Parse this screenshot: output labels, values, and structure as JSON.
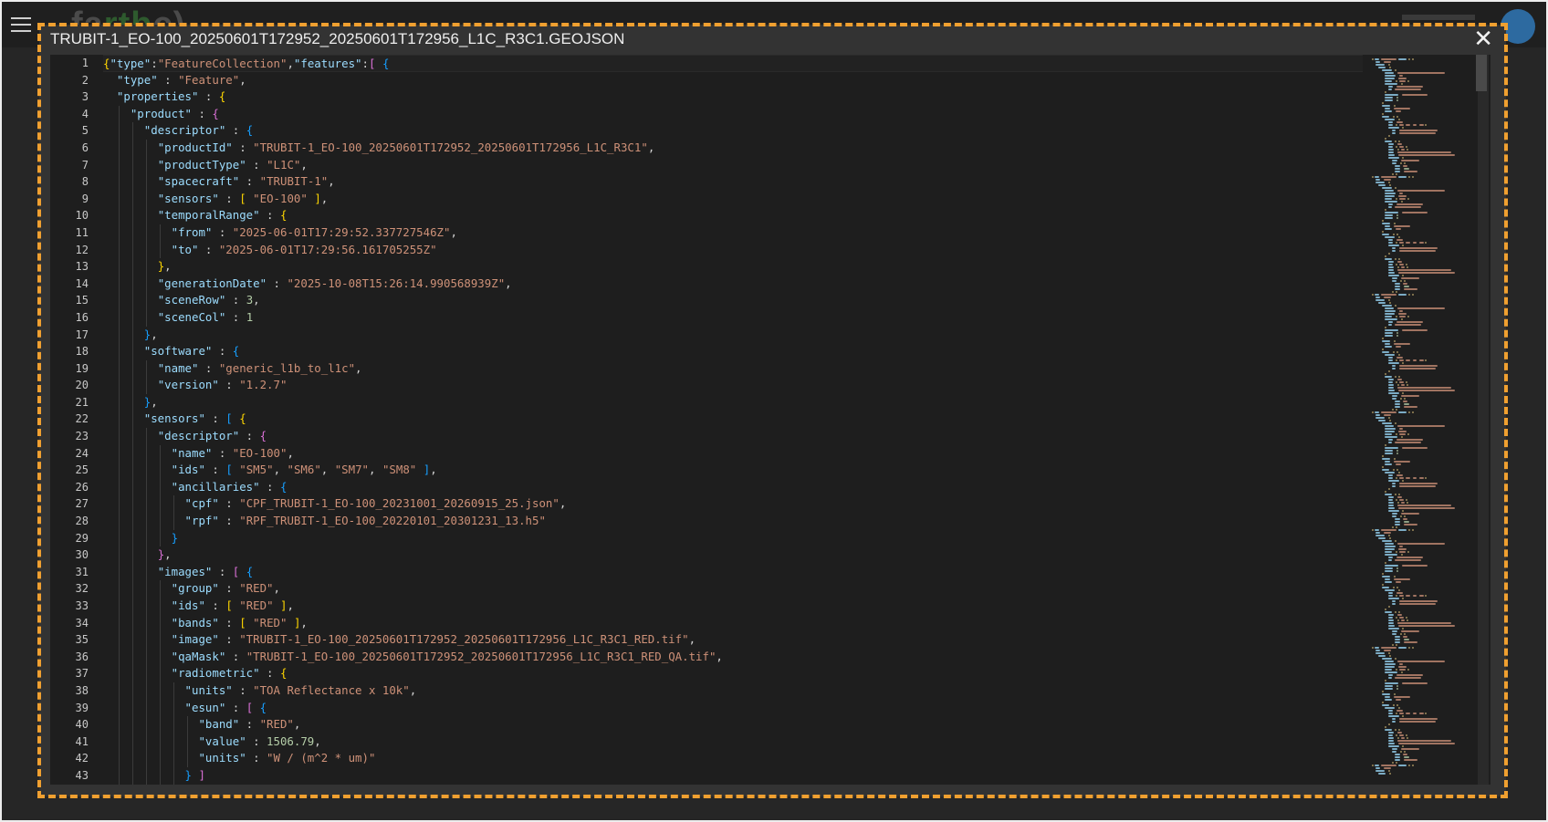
{
  "app": {
    "logo_text": "fa",
    "logo_accent": "rth",
    "logo_tail": "c)"
  },
  "modal": {
    "title": "TRUBIT-1_EO-100_20250601T172952_20250601T172956_L1C_R3C1.GEOJSON",
    "close_label": "✕"
  },
  "editor": {
    "language": "json",
    "visible_lines": [
      [
        [
          "b1",
          "{"
        ],
        [
          "k",
          "\"type\""
        ],
        [
          "p",
          ":"
        ],
        [
          "s",
          "\"FeatureCollection\""
        ],
        [
          "p",
          ","
        ],
        [
          "k",
          "\"features\""
        ],
        [
          "p",
          ":"
        ],
        [
          "b2",
          "["
        ],
        [
          "p",
          " "
        ],
        [
          "b3",
          "{"
        ]
      ],
      [
        [
          "p",
          "  "
        ],
        [
          "k",
          "\"type\""
        ],
        [
          "p",
          " : "
        ],
        [
          "s",
          "\"Feature\""
        ],
        [
          "p",
          ","
        ]
      ],
      [
        [
          "p",
          "  "
        ],
        [
          "k",
          "\"properties\""
        ],
        [
          "p",
          " : "
        ],
        [
          "b1",
          "{"
        ]
      ],
      [
        [
          "p",
          "    "
        ],
        [
          "k",
          "\"product\""
        ],
        [
          "p",
          " : "
        ],
        [
          "b2",
          "{"
        ]
      ],
      [
        [
          "p",
          "      "
        ],
        [
          "k",
          "\"descriptor\""
        ],
        [
          "p",
          " : "
        ],
        [
          "b3",
          "{"
        ]
      ],
      [
        [
          "p",
          "        "
        ],
        [
          "k",
          "\"productId\""
        ],
        [
          "p",
          " : "
        ],
        [
          "s",
          "\"TRUBIT-1_EO-100_20250601T172952_20250601T172956_L1C_R3C1\""
        ],
        [
          "p",
          ","
        ]
      ],
      [
        [
          "p",
          "        "
        ],
        [
          "k",
          "\"productType\""
        ],
        [
          "p",
          " : "
        ],
        [
          "s",
          "\"L1C\""
        ],
        [
          "p",
          ","
        ]
      ],
      [
        [
          "p",
          "        "
        ],
        [
          "k",
          "\"spacecraft\""
        ],
        [
          "p",
          " : "
        ],
        [
          "s",
          "\"TRUBIT-1\""
        ],
        [
          "p",
          ","
        ]
      ],
      [
        [
          "p",
          "        "
        ],
        [
          "k",
          "\"sensors\""
        ],
        [
          "p",
          " : "
        ],
        [
          "b1",
          "["
        ],
        [
          "p",
          " "
        ],
        [
          "s",
          "\"EO-100\""
        ],
        [
          "p",
          " "
        ],
        [
          "b1",
          "]"
        ],
        [
          "p",
          ","
        ]
      ],
      [
        [
          "p",
          "        "
        ],
        [
          "k",
          "\"temporalRange\""
        ],
        [
          "p",
          " : "
        ],
        [
          "b1",
          "{"
        ]
      ],
      [
        [
          "p",
          "          "
        ],
        [
          "k",
          "\"from\""
        ],
        [
          "p",
          " : "
        ],
        [
          "s",
          "\"2025-06-01T17:29:52.337727546Z\""
        ],
        [
          "p",
          ","
        ]
      ],
      [
        [
          "p",
          "          "
        ],
        [
          "k",
          "\"to\""
        ],
        [
          "p",
          " : "
        ],
        [
          "s",
          "\"2025-06-01T17:29:56.161705255Z\""
        ]
      ],
      [
        [
          "p",
          "        "
        ],
        [
          "b1",
          "}"
        ],
        [
          "p",
          ","
        ]
      ],
      [
        [
          "p",
          "        "
        ],
        [
          "k",
          "\"generationDate\""
        ],
        [
          "p",
          " : "
        ],
        [
          "s",
          "\"2025-10-08T15:26:14.990568939Z\""
        ],
        [
          "p",
          ","
        ]
      ],
      [
        [
          "p",
          "        "
        ],
        [
          "k",
          "\"sceneRow\""
        ],
        [
          "p",
          " : "
        ],
        [
          "n",
          "3"
        ],
        [
          "p",
          ","
        ]
      ],
      [
        [
          "p",
          "        "
        ],
        [
          "k",
          "\"sceneCol\""
        ],
        [
          "p",
          " : "
        ],
        [
          "n",
          "1"
        ]
      ],
      [
        [
          "p",
          "      "
        ],
        [
          "b3",
          "}"
        ],
        [
          "p",
          ","
        ]
      ],
      [
        [
          "p",
          "      "
        ],
        [
          "k",
          "\"software\""
        ],
        [
          "p",
          " : "
        ],
        [
          "b3",
          "{"
        ]
      ],
      [
        [
          "p",
          "        "
        ],
        [
          "k",
          "\"name\""
        ],
        [
          "p",
          " : "
        ],
        [
          "s",
          "\"generic_l1b_to_l1c\""
        ],
        [
          "p",
          ","
        ]
      ],
      [
        [
          "p",
          "        "
        ],
        [
          "k",
          "\"version\""
        ],
        [
          "p",
          " : "
        ],
        [
          "s",
          "\"1.2.7\""
        ]
      ],
      [
        [
          "p",
          "      "
        ],
        [
          "b3",
          "}"
        ],
        [
          "p",
          ","
        ]
      ],
      [
        [
          "p",
          "      "
        ],
        [
          "k",
          "\"sensors\""
        ],
        [
          "p",
          " : "
        ],
        [
          "b3",
          "["
        ],
        [
          "p",
          " "
        ],
        [
          "b1",
          "{"
        ]
      ],
      [
        [
          "p",
          "        "
        ],
        [
          "k",
          "\"descriptor\""
        ],
        [
          "p",
          " : "
        ],
        [
          "b2",
          "{"
        ]
      ],
      [
        [
          "p",
          "          "
        ],
        [
          "k",
          "\"name\""
        ],
        [
          "p",
          " : "
        ],
        [
          "s",
          "\"EO-100\""
        ],
        [
          "p",
          ","
        ]
      ],
      [
        [
          "p",
          "          "
        ],
        [
          "k",
          "\"ids\""
        ],
        [
          "p",
          " : "
        ],
        [
          "b3",
          "["
        ],
        [
          "p",
          " "
        ],
        [
          "s",
          "\"SM5\""
        ],
        [
          "p",
          ", "
        ],
        [
          "s",
          "\"SM6\""
        ],
        [
          "p",
          ", "
        ],
        [
          "s",
          "\"SM7\""
        ],
        [
          "p",
          ", "
        ],
        [
          "s",
          "\"SM8\""
        ],
        [
          "p",
          " "
        ],
        [
          "b3",
          "]"
        ],
        [
          "p",
          ","
        ]
      ],
      [
        [
          "p",
          "          "
        ],
        [
          "k",
          "\"ancillaries\""
        ],
        [
          "p",
          " : "
        ],
        [
          "b3",
          "{"
        ]
      ],
      [
        [
          "p",
          "            "
        ],
        [
          "k",
          "\"cpf\""
        ],
        [
          "p",
          " : "
        ],
        [
          "s",
          "\"CPF_TRUBIT-1_EO-100_20231001_20260915_25.json\""
        ],
        [
          "p",
          ","
        ]
      ],
      [
        [
          "p",
          "            "
        ],
        [
          "k",
          "\"rpf\""
        ],
        [
          "p",
          " : "
        ],
        [
          "s",
          "\"RPF_TRUBIT-1_EO-100_20220101_20301231_13.h5\""
        ]
      ],
      [
        [
          "p",
          "          "
        ],
        [
          "b3",
          "}"
        ]
      ],
      [
        [
          "p",
          "        "
        ],
        [
          "b2",
          "}"
        ],
        [
          "p",
          ","
        ]
      ],
      [
        [
          "p",
          "        "
        ],
        [
          "k",
          "\"images\""
        ],
        [
          "p",
          " : "
        ],
        [
          "b2",
          "["
        ],
        [
          "p",
          " "
        ],
        [
          "b3",
          "{"
        ]
      ],
      [
        [
          "p",
          "          "
        ],
        [
          "k",
          "\"group\""
        ],
        [
          "p",
          " : "
        ],
        [
          "s",
          "\"RED\""
        ],
        [
          "p",
          ","
        ]
      ],
      [
        [
          "p",
          "          "
        ],
        [
          "k",
          "\"ids\""
        ],
        [
          "p",
          " : "
        ],
        [
          "b1",
          "["
        ],
        [
          "p",
          " "
        ],
        [
          "s",
          "\"RED\""
        ],
        [
          "p",
          " "
        ],
        [
          "b1",
          "]"
        ],
        [
          "p",
          ","
        ]
      ],
      [
        [
          "p",
          "          "
        ],
        [
          "k",
          "\"bands\""
        ],
        [
          "p",
          " : "
        ],
        [
          "b1",
          "["
        ],
        [
          "p",
          " "
        ],
        [
          "s",
          "\"RED\""
        ],
        [
          "p",
          " "
        ],
        [
          "b1",
          "]"
        ],
        [
          "p",
          ","
        ]
      ],
      [
        [
          "p",
          "          "
        ],
        [
          "k",
          "\"image\""
        ],
        [
          "p",
          " : "
        ],
        [
          "s",
          "\"TRUBIT-1_EO-100_20250601T172952_20250601T172956_L1C_R3C1_RED.tif\""
        ],
        [
          "p",
          ","
        ]
      ],
      [
        [
          "p",
          "          "
        ],
        [
          "k",
          "\"qaMask\""
        ],
        [
          "p",
          " : "
        ],
        [
          "s",
          "\"TRUBIT-1_EO-100_20250601T172952_20250601T172956_L1C_R3C1_RED_QA.tif\""
        ],
        [
          "p",
          ","
        ]
      ],
      [
        [
          "p",
          "          "
        ],
        [
          "k",
          "\"radiometric\""
        ],
        [
          "p",
          " : "
        ],
        [
          "b1",
          "{"
        ]
      ],
      [
        [
          "p",
          "            "
        ],
        [
          "k",
          "\"units\""
        ],
        [
          "p",
          " : "
        ],
        [
          "s",
          "\"TOA Reflectance x 10k\""
        ],
        [
          "p",
          ","
        ]
      ],
      [
        [
          "p",
          "            "
        ],
        [
          "k",
          "\"esun\""
        ],
        [
          "p",
          " : "
        ],
        [
          "b2",
          "["
        ],
        [
          "p",
          " "
        ],
        [
          "b3",
          "{"
        ]
      ],
      [
        [
          "p",
          "              "
        ],
        [
          "k",
          "\"band\""
        ],
        [
          "p",
          " : "
        ],
        [
          "s",
          "\"RED\""
        ],
        [
          "p",
          ","
        ]
      ],
      [
        [
          "p",
          "              "
        ],
        [
          "k",
          "\"value\""
        ],
        [
          "p",
          " : "
        ],
        [
          "n",
          "1506.79"
        ],
        [
          "p",
          ","
        ]
      ],
      [
        [
          "p",
          "              "
        ],
        [
          "k",
          "\"units\""
        ],
        [
          "p",
          " : "
        ],
        [
          "s",
          "\"W / (m^2 * um)\""
        ]
      ],
      [
        [
          "p",
          "            "
        ],
        [
          "b3",
          "}"
        ],
        [
          "p",
          " "
        ],
        [
          "b2",
          "]"
        ]
      ]
    ],
    "first_line_number": 1
  }
}
